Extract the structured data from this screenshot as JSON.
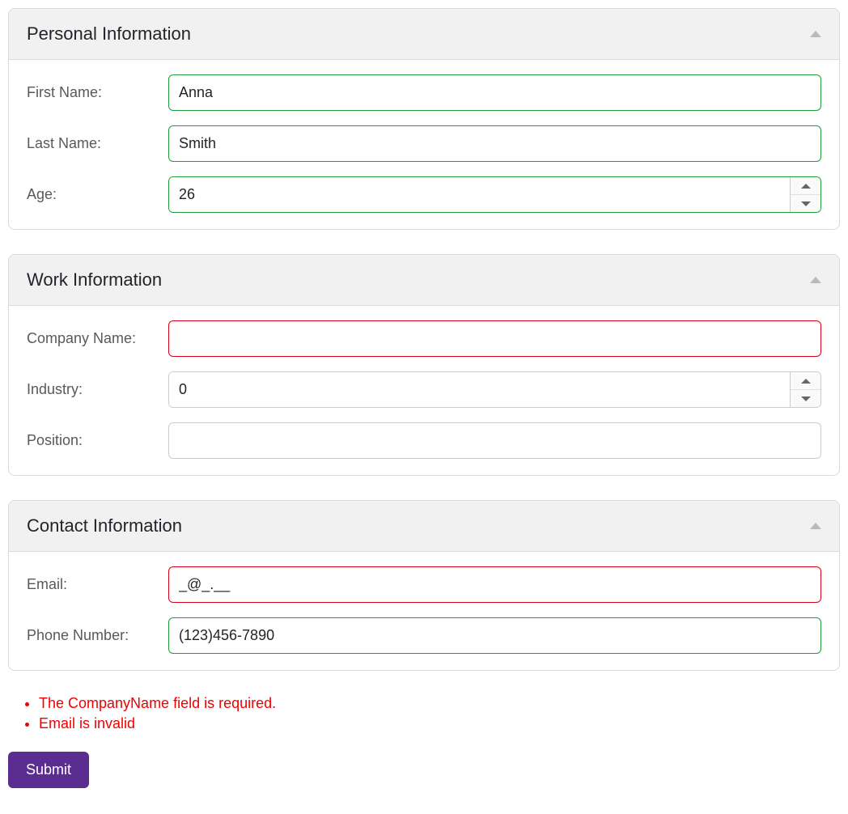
{
  "panels": {
    "personal": {
      "title": "Personal Information",
      "firstNameLabel": "First Name:",
      "firstNameValue": "Anna",
      "lastNameLabel": "Last Name:",
      "lastNameValue": "Smith",
      "ageLabel": "Age:",
      "ageValue": "26"
    },
    "work": {
      "title": "Work Information",
      "companyLabel": "Company Name:",
      "companyValue": "",
      "industryLabel": "Industry:",
      "industryValue": "0",
      "positionLabel": "Position:",
      "positionValue": ""
    },
    "contact": {
      "title": "Contact Information",
      "emailLabel": "Email:",
      "emailValue": "_@_.__",
      "phoneLabel": "Phone Number:",
      "phoneValue": "(123)456-7890"
    }
  },
  "validation": {
    "errors": [
      "The CompanyName field is required.",
      "Email is invalid"
    ]
  },
  "actions": {
    "submitLabel": "Submit"
  }
}
